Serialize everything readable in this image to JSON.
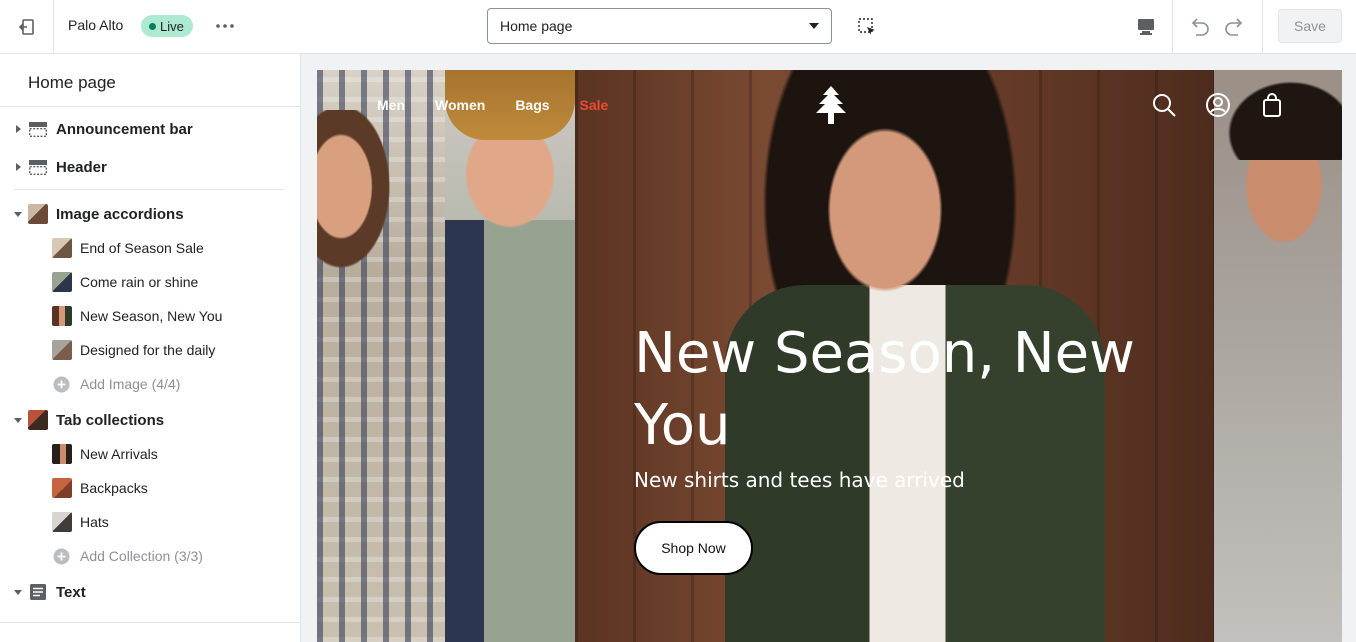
{
  "topbar": {
    "theme_name": "Palo Alto",
    "live_label": "Live",
    "page_select": "Home page",
    "save_label": "Save"
  },
  "sidebar": {
    "title": "Home page",
    "sections": [
      {
        "label": "Announcement bar",
        "icon": "layout-bar-icon",
        "expanded": false
      },
      {
        "label": "Header",
        "icon": "layout-header-icon",
        "expanded": false
      },
      {
        "label": "Image accordions",
        "icon": "image-thumb-icon",
        "expanded": true,
        "blocks": [
          "End of Season Sale",
          "Come rain or shine",
          "New Season, New You",
          "Designed for the daily"
        ],
        "add_label": "Add Image (4/4)"
      },
      {
        "label": "Tab collections",
        "icon": "image-thumb-icon",
        "expanded": true,
        "blocks": [
          "New Arrivals",
          "Backpacks",
          "Hats"
        ],
        "add_label": "Add Collection (3/3)"
      },
      {
        "label": "Text",
        "icon": "text-icon",
        "expanded": true
      }
    ]
  },
  "preview": {
    "nav": [
      "Men",
      "Women",
      "Bags",
      "Sale"
    ],
    "hero": {
      "title": "New Season, New You",
      "subtitle": "New shirts and tees have arrived",
      "button": "Shop Now"
    }
  },
  "colors": {
    "live_badge": "#aee9d1",
    "sale_link": "#e94b35",
    "border": "#e1e3e5"
  }
}
